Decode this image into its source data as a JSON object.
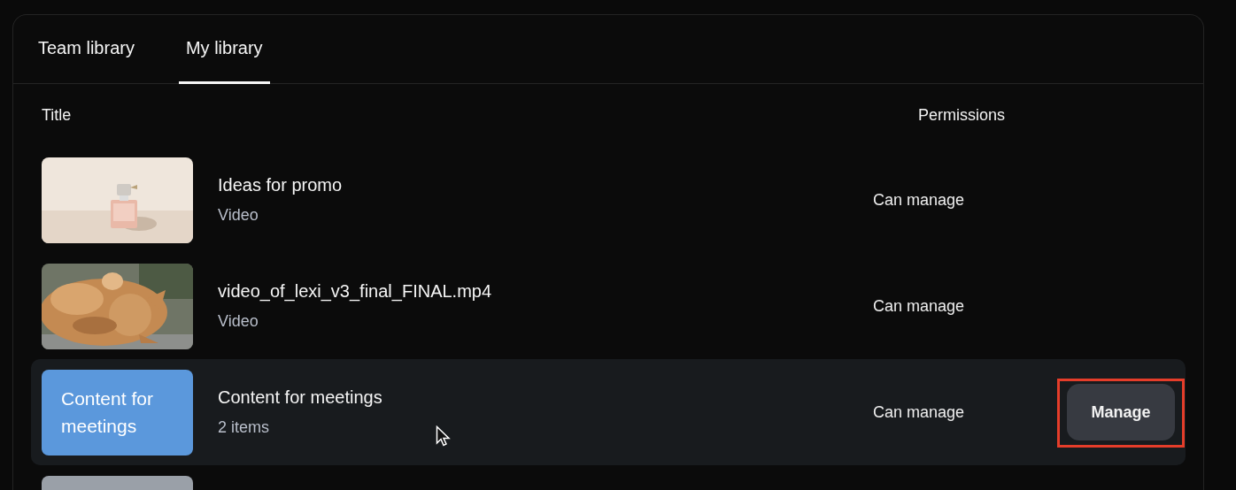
{
  "tabs": [
    {
      "label": "Team library",
      "selected": false
    },
    {
      "label": "My library",
      "selected": true
    }
  ],
  "columns": [
    "Title",
    "Permissions"
  ],
  "rows": [
    {
      "title": "Ideas for promo",
      "subtitle": "Video",
      "permission": "Can manage",
      "hovered": false
    },
    {
      "title": "video_of_lexi_v3_final_FINAL.mp4",
      "subtitle": "Video",
      "permission": "Can manage",
      "hovered": false
    },
    {
      "thumbnail": {
        "kind": "folder",
        "color": "#5b98dc",
        "label": "Content for meetings"
      },
      "title": "Content for meetings",
      "subtitle": "2 items",
      "permission": "Can manage",
      "hovered": true,
      "action": "Manage",
      "action_highlighted": true
    },
    {
      "thumbnail": {
        "kind": "folder",
        "color": "#9aa0a8"
      },
      "hovered": false
    }
  ]
}
